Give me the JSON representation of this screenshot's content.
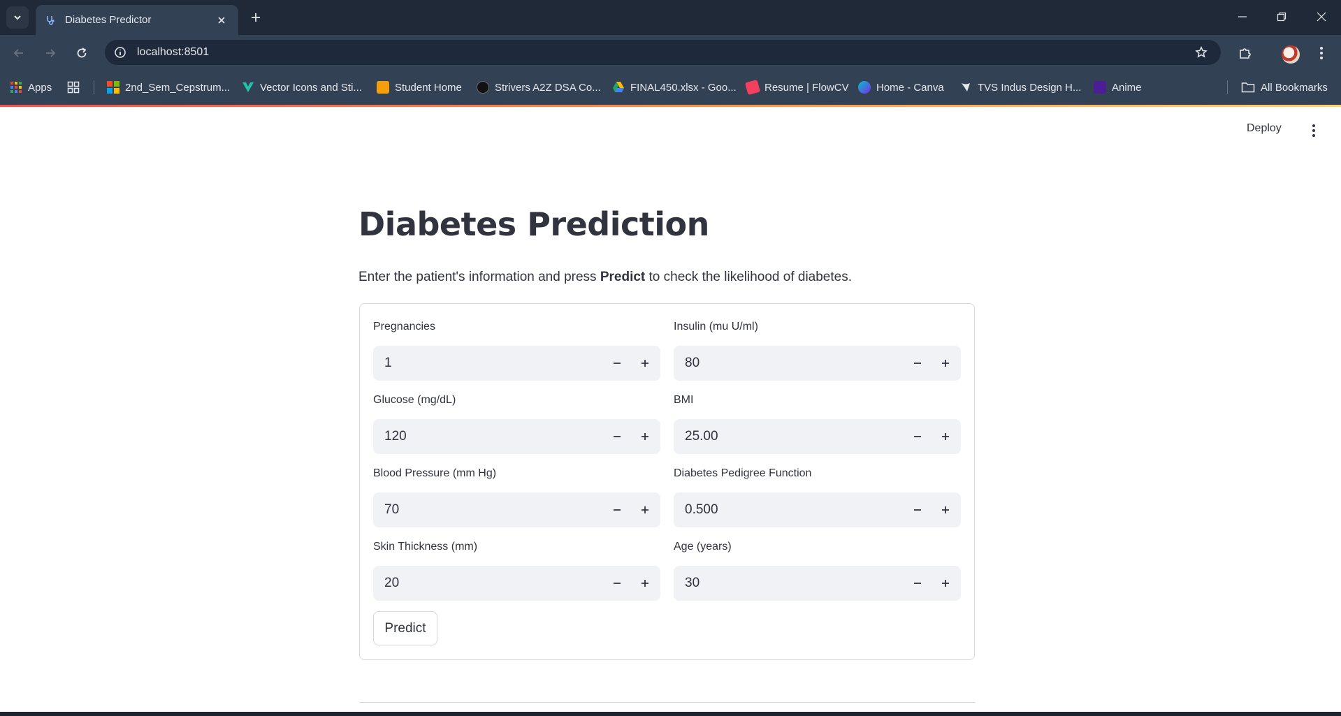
{
  "browser": {
    "tab_title": "Diabetes Predictor",
    "url": "localhost:8501",
    "bookmarks": [
      {
        "label": "Apps",
        "color": "#ea4335"
      },
      {
        "label": "2nd_Sem_Cepstrum...",
        "color": "#f25022"
      },
      {
        "label": "Vector Icons and Sti...",
        "color": "#22c3a6"
      },
      {
        "label": "Student Home",
        "color": "#f59e0b"
      },
      {
        "label": "Strivers A2Z DSA Co...",
        "color": "#111111"
      },
      {
        "label": "FINAL450.xlsx - Goo...",
        "color": "#1fa463"
      },
      {
        "label": "Resume | FlowCV",
        "color": "#f43f5e"
      },
      {
        "label": "Home - Canva",
        "color": "#00c4cc"
      },
      {
        "label": "TVS Indus Design H...",
        "color": "#e5e7eb"
      },
      {
        "label": "Anime",
        "color": "#7c3aed"
      }
    ],
    "all_bookmarks": "All Bookmarks"
  },
  "app": {
    "deploy_label": "Deploy",
    "title": "Diabetes Prediction",
    "desc_prefix": "Enter the patient's information and press ",
    "desc_bold": "Predict",
    "desc_suffix": " to check the likelihood of diabetes.",
    "fields": {
      "pregnancies": {
        "label": "Pregnancies",
        "value": "1"
      },
      "insulin": {
        "label": "Insulin (mu U/ml)",
        "value": "80"
      },
      "glucose": {
        "label": "Glucose (mg/dL)",
        "value": "120"
      },
      "bmi": {
        "label": "BMI",
        "value": "25.00"
      },
      "blood_pressure": {
        "label": "Blood Pressure (mm Hg)",
        "value": "70"
      },
      "pedigree": {
        "label": "Diabetes Pedigree Function",
        "value": "0.500"
      },
      "skin": {
        "label": "Skin Thickness (mm)",
        "value": "20"
      },
      "age": {
        "label": "Age (years)",
        "value": "30"
      }
    },
    "predict_label": "Predict"
  }
}
